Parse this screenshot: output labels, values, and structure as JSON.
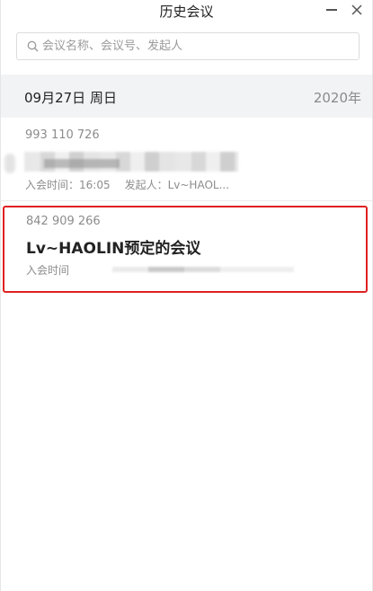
{
  "window": {
    "title": "历史会议"
  },
  "search": {
    "placeholder": "会议名称、会议号、发起人"
  },
  "date_group": {
    "date": "09月27日 周日",
    "year": "2020年"
  },
  "meetings": [
    {
      "number": "993 110 726",
      "topic": "",
      "join_time_label": "入会时间：16:05",
      "initiator_label": "发起人：Lv~HAOL..."
    },
    {
      "number": "842 909 266",
      "topic": "Lv~HAOLIN预定的会议",
      "join_time_label": "入会时间"
    }
  ],
  "colors": {
    "highlight_border": "#e02020",
    "date_header_bg": "#f2f3f5"
  }
}
